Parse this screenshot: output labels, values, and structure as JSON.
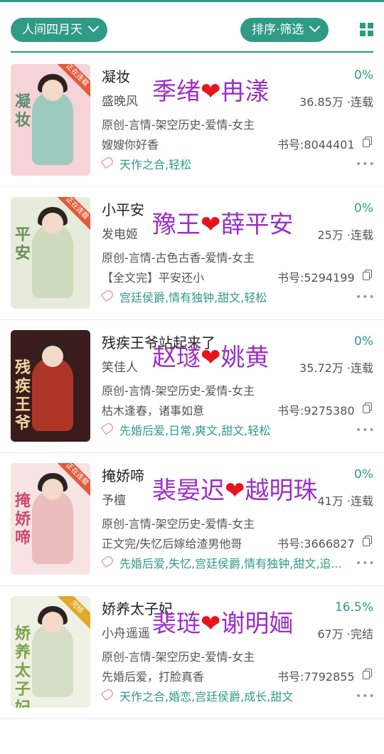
{
  "filters": {
    "category": "人间四月天",
    "sort": "排序·筛选"
  },
  "colors": {
    "accent": "#2f9a86",
    "overlay_text": "#9b2fc9",
    "heart": "#e8141b"
  },
  "books": [
    {
      "title": "凝妆",
      "progress": "0%",
      "author": "盛晚风",
      "stats": "36.85万 ·连载",
      "overlay": {
        "left": "季绪",
        "right": "冉漾"
      },
      "genre": "原创-言情-架空历史-爱情-女主",
      "intro": "嫂嫂你好香",
      "book_id": "书号:8044401",
      "tags": "天作之合,轻松",
      "cover": {
        "title": "凝妆",
        "ribbon": "正在连载",
        "bg": "#f6d3d9",
        "figure": "#8cc9b9",
        "ink": "#5a8f6a"
      }
    },
    {
      "title": "小平安",
      "progress": "0%",
      "author": "发电姬",
      "stats": "25万 ·连载",
      "overlay": {
        "left": "豫王",
        "right": "薛平安"
      },
      "genre": "原创-言情-古色古香-爱情-女主",
      "intro": "【全文完】平安还小",
      "book_id": "书号:5294199",
      "tags": "宫廷侯爵,情有独钟,甜文,轻松",
      "cover": {
        "title": "平安",
        "ribbon": "正在连载",
        "bg": "#e6ebdc",
        "figure": "#c9d7b7",
        "ink": "#6a8f5a"
      }
    },
    {
      "title": "残疾王爷站起来了",
      "progress": "0%",
      "author": "笑佳人",
      "stats": "35.72万 ·连载",
      "overlay": {
        "left": "赵璲",
        "right": "姚黄"
      },
      "genre": "原创-言情-架空历史-爱情-女主",
      "intro": "枯木逢春，诸事如意",
      "book_id": "书号:9275380",
      "tags": "先婚后爱,日常,爽文,甜文,轻松",
      "cover": {
        "title": "残疾王爷",
        "ribbon": "",
        "bg": "#3a1c1c",
        "figure": "#c23a2a",
        "ink": "#f3d7a0"
      }
    },
    {
      "title": "掩娇啼",
      "progress": "0%",
      "author": "予檀",
      "stats": "41万 ·连载",
      "overlay": {
        "left": "裴晏迟",
        "right": "越明珠"
      },
      "genre": "原创-言情-架空历史-爱情-女主",
      "intro": "正文完/失忆后嫁给渣男他哥",
      "book_id": "书号:3666827",
      "tags": "先婚后爱,失忆,宫廷侯爵,情有独钟,甜文,追...",
      "cover": {
        "title": "掩娇啼",
        "ribbon": "正在连载",
        "bg": "#f8e4e4",
        "figure": "#e9b6b6",
        "ink": "#c94a6a"
      }
    },
    {
      "title": "娇养太子妃",
      "progress": "16.5%",
      "author": "小舟遥遥",
      "stats": "67万 ·完结",
      "overlay": {
        "left": "裴琏",
        "right": "谢明婳"
      },
      "genre": "原创-言情-架空历史-爱情-女主",
      "intro": "先婚后爱，打脸真香",
      "book_id": "书号:7792855",
      "tags": "天作之合,婚恋,宫廷侯爵,成长,甜文",
      "cover": {
        "title": "娇养太子妃",
        "ribbon": "完结",
        "bg": "#eef1e4",
        "figure": "#cfdcc0",
        "ink": "#7aa24a"
      }
    }
  ]
}
